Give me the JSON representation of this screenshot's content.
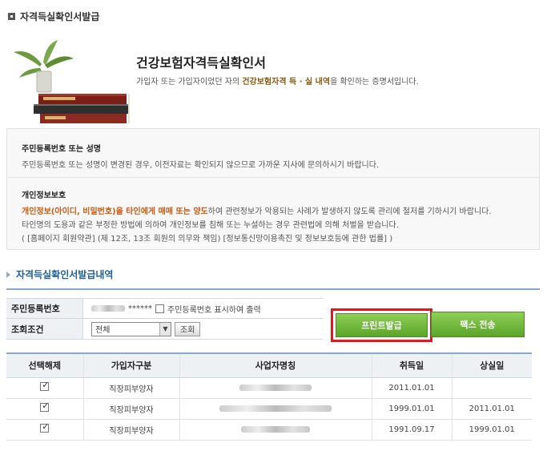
{
  "page_title": "자격득실확인서발급",
  "hero": {
    "title": "건강보험자격득실확인서",
    "desc_prefix": "가입자 또는 가입자이었던 자의 ",
    "desc_highlight": "건강보험자격 득 · 실 내역",
    "desc_suffix": "을 확인하는 증명서입니다."
  },
  "notice": {
    "section1_head": "주민등록번호 또는 성명",
    "section1_text": "주민등록번호 또는 성명이 변경된 경우, 이전자료는 확인되지 않으므로 가까운 지사에 문의하시기 바랍니다.",
    "section2_head": "개인정보보호",
    "section2_line1_orange": "개인정보(아이디, 비밀번호)을 타인에게 매매 또는 양도",
    "section2_line1_rest": "하여 관련정보가 악용되는 사례가 발생하지 않도록 관리에 철저를 기하시기 바랍니다.",
    "section2_line2": "타인명의 도용과 같은 부정한 방법에 의하여 개인정보를 침해 또는 누설하는 경우 관련법에 의해 처벌을 받습니다.",
    "section2_line3": "( [홈페이지 회원약관] (제 12조, 13조 회원의 의무와 책임) [정보통신망이용촉진 및 정보보호등에 관한 법률] )"
  },
  "history_title": "자격득실확인서발급내역",
  "form": {
    "rrn_label": "주민등록번호",
    "rrn_value": "******",
    "rrn_print_label": "주민등록번호 표시하여 출력",
    "condition_label": "조회조건",
    "condition_value": "전체",
    "search_button": "조회"
  },
  "buttons": {
    "print": "프린트발급",
    "fax": "팩스 전송"
  },
  "table": {
    "headers": [
      "선택해제",
      "가입자구분",
      "사업자명칭",
      "취득일",
      "상실일"
    ],
    "rows": [
      {
        "type": "직장피부양자",
        "acquired": "2011.01.01",
        "lost": ""
      },
      {
        "type": "직장피부양자",
        "acquired": "1999.01.01",
        "lost": "2011.01.01"
      },
      {
        "type": "직장피부양자",
        "acquired": "1991.09.17",
        "lost": "1999.01.01"
      }
    ]
  }
}
